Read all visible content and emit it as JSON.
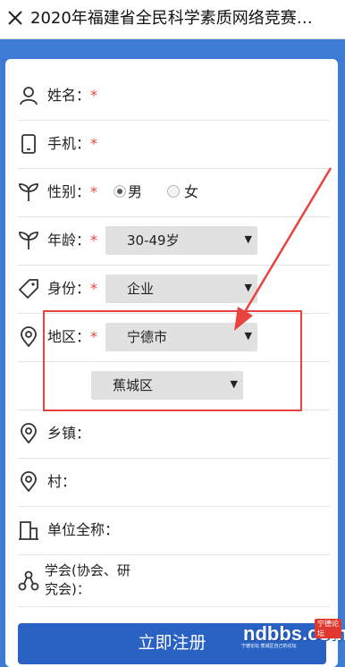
{
  "header": {
    "title": "2020年福建省全民科学素质网络竞赛…"
  },
  "form": {
    "required_mark": "*",
    "name": {
      "label": "姓名："
    },
    "phone": {
      "label": "手机："
    },
    "gender": {
      "label": "性别：",
      "options": [
        "男",
        "女"
      ],
      "selected": "男"
    },
    "age": {
      "label": "年龄：",
      "value": "30-49岁"
    },
    "identity": {
      "label": "身份：",
      "value": "企业"
    },
    "region": {
      "label": "地区：",
      "city": "宁德市",
      "district": "蕉城区"
    },
    "town": {
      "label": "乡镇："
    },
    "village": {
      "label": "村："
    },
    "organization": {
      "label": "单位全称："
    },
    "society": {
      "label_line1": "学会(协会、研",
      "label_line2": "究会)："
    },
    "submit_label": "立即注册"
  },
  "watermark": {
    "text": "ndbbs.com",
    "badge": "宁德论坛",
    "sub": "宁德论坛 蕉城区自己的论坛"
  },
  "colors": {
    "accent": "#2a62c4",
    "required": "#e04a3f",
    "highlight": "#e8433e",
    "background": "#3d7bd4"
  },
  "icons": {
    "close": "close-icon",
    "name": "person-icon",
    "phone": "phone-icon",
    "gender": "sprout-icon",
    "age": "sprout-icon",
    "identity": "tag-icon",
    "region": "location-pin-icon",
    "town": "location-pin-icon",
    "village": "location-pin-icon",
    "organization": "building-icon",
    "society": "network-icon"
  }
}
